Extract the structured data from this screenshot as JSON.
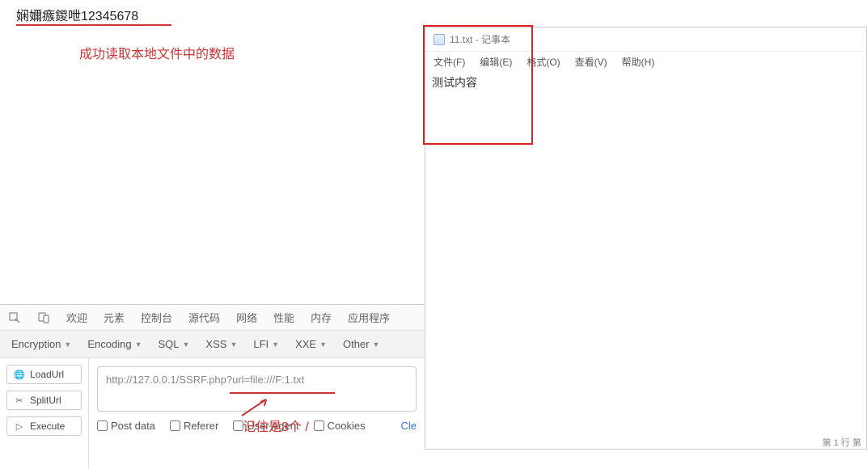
{
  "output_text": "娴嬭瘯鍐呭12345678",
  "annotations": {
    "success_read": "成功读取本地文件中的数据",
    "three_slashes": "记住是3个  /"
  },
  "notepad": {
    "title": "11.txt - 记事本",
    "menus": [
      "文件(F)",
      "编辑(E)",
      "格式(O)",
      "查看(V)",
      "帮助(H)"
    ],
    "content": "测试内容",
    "status": "第 1 行  第"
  },
  "devtools": {
    "tabs": [
      "欢迎",
      "元素",
      "控制台",
      "源代码",
      "网络",
      "性能",
      "内存",
      "应用程序"
    ],
    "toolbar": [
      "Encryption",
      "Encoding",
      "SQL",
      "XSS",
      "LFI",
      "XXE",
      "Other"
    ],
    "sidebar": {
      "loadurl": "LoadUrl",
      "spliturl": "SplitUrl",
      "execute": "Execute"
    },
    "url_value": "http://127.0.0.1/SSRF.php?url=file:///F:1.txt",
    "options": {
      "postdata": "Post data",
      "referer": "Referer",
      "useragent": "User Agent",
      "cookies": "Cookies"
    },
    "clear": "Cle"
  }
}
